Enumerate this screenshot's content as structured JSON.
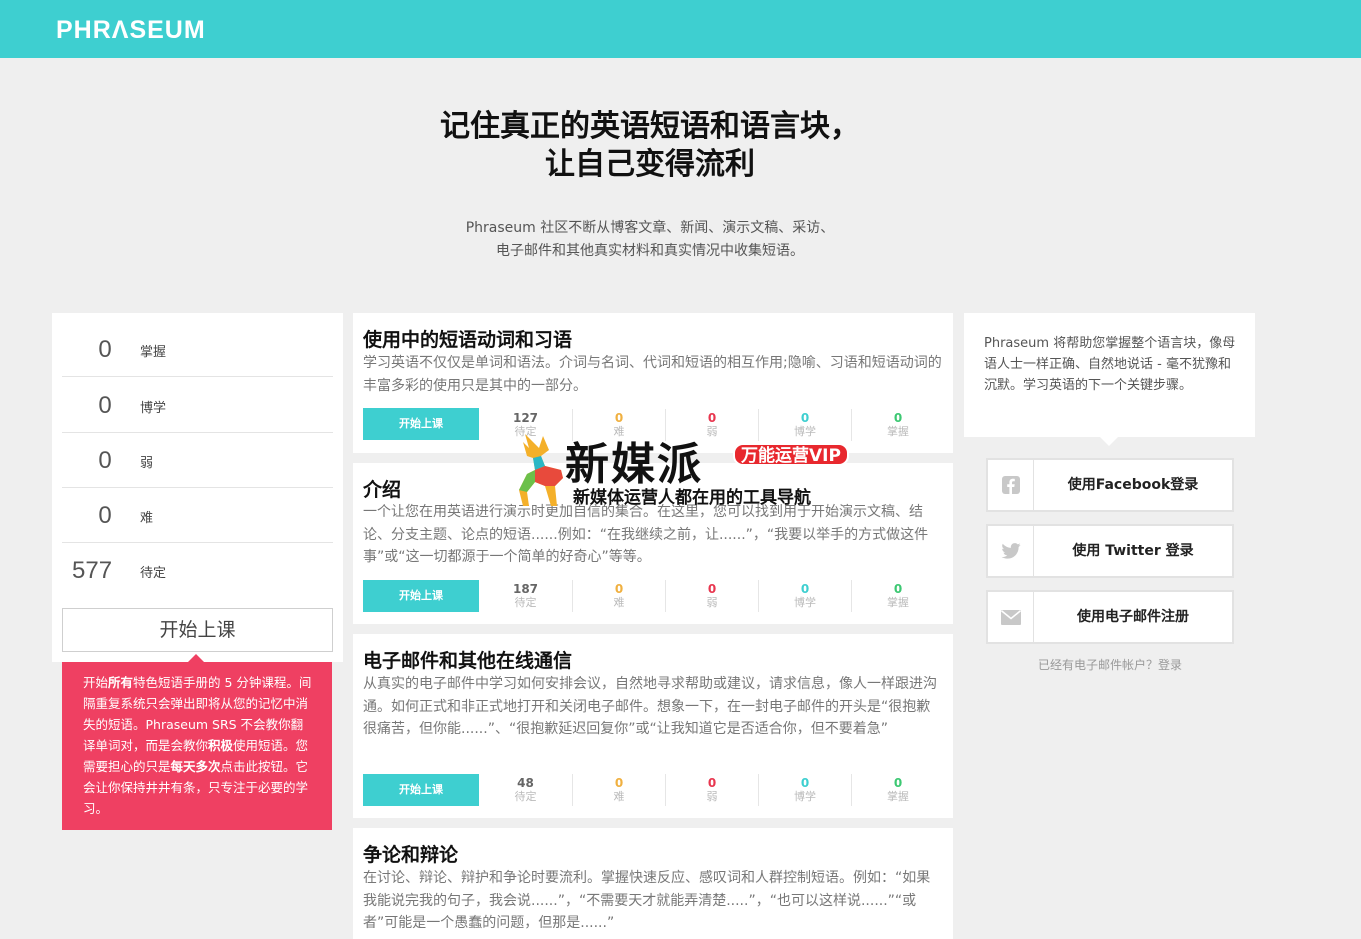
{
  "header": {
    "logo": "PHRΛSEUM"
  },
  "hero": {
    "title_line1": "记住真正的英语短语和语言块，",
    "title_line2": "让自己变得流利",
    "sub_line1": "Phraseum 社区不断从博客文章、新闻、演示文稿、采访、",
    "sub_line2": "电子邮件和其他真实材料和真实情况中收集短语。"
  },
  "stats": [
    {
      "value": "0",
      "label": "掌握"
    },
    {
      "value": "0",
      "label": "博学"
    },
    {
      "value": "0",
      "label": "弱"
    },
    {
      "value": "0",
      "label": "难"
    },
    {
      "value": "577",
      "label": "待定"
    }
  ],
  "start_button": "开始上课",
  "tip": {
    "p1": "开始",
    "b1": "所有",
    "p2": "特色短语手册的 5 分钟课程。间隔重复系统只会弹出即将从您的记忆中消失的短语。Phraseum SRS 不会教你翻译单词对，而是会教你",
    "b2": "积极",
    "p3": "使用短语。您需要担心的只是",
    "b3": "每天多次",
    "p4": "点击此按钮。它会让你保持井井有条，只专注于必要的学习。"
  },
  "cards": [
    {
      "title": "使用中的短语动词和习语",
      "desc": "学习英语不仅仅是单词和语法。介词与名词、代词和短语的相互作用;隐喻、习语和短语动词的丰富多彩的使用只是其中的一部分。",
      "button": "开始上课",
      "metrics": [
        {
          "value": "127",
          "label": "待定"
        },
        {
          "value": "0",
          "label": "难"
        },
        {
          "value": "0",
          "label": "弱"
        },
        {
          "value": "0",
          "label": "博学"
        },
        {
          "value": "0",
          "label": "掌握"
        }
      ]
    },
    {
      "title": "介绍",
      "desc": "一个让您在用英语进行演示时更加自信的集合。在这里，您可以找到用于开始演示文稿、结论、分支主题、论点的短语......例如：“在我继续之前，让......”，“我要以举手的方式做这件事”或“这一切都源于一个简单的好奇心”等等。",
      "button": "开始上课",
      "metrics": [
        {
          "value": "187",
          "label": "待定"
        },
        {
          "value": "0",
          "label": "难"
        },
        {
          "value": "0",
          "label": "弱"
        },
        {
          "value": "0",
          "label": "博学"
        },
        {
          "value": "0",
          "label": "掌握"
        }
      ]
    },
    {
      "title": "电子邮件和其他在线通信",
      "desc": "从真实的电子邮件中学习如何安排会议，自然地寻求帮助或建议，请求信息，像人一样跟进沟通。如何正式和非正式地打开和关闭电子邮件。想象一下，在一封电子邮件的开头是“很抱歉很痛苦，但你能......”、“很抱歉延迟回复你”或“让我知道它是否适合你，但不要着急”",
      "button": "开始上课",
      "metrics": [
        {
          "value": "48",
          "label": "待定"
        },
        {
          "value": "0",
          "label": "难"
        },
        {
          "value": "0",
          "label": "弱"
        },
        {
          "value": "0",
          "label": "博学"
        },
        {
          "value": "0",
          "label": "掌握"
        }
      ]
    },
    {
      "title": "争论和辩论",
      "desc": "在讨论、辩论、辩护和争论时要流利。掌握快速反应、感叹词和人群控制短语。例如：“如果我能说完我的句子，我会说......”，“不需要天才就能弄清楚.....”，“也可以这样说......”“或者”可能是一个愚蠢的问题，但那是......”"
    }
  ],
  "right": {
    "blurb": "Phraseum 将帮助您掌握整个语言块，像母语人士一样正确、自然地说话 - 毫不犹豫和沉默。学习英语的下一个关键步骤。",
    "facebook": "使用Facebook登录",
    "twitter": "使用 Twitter 登录",
    "email": "使用电子邮件注册",
    "already": "已经有电子邮件帐户？登录"
  },
  "watermark": {
    "brand": "新媒派",
    "badge": "万能运营VIP",
    "tagline": "新媒体运营人都在用的工具导航"
  },
  "colors": {
    "accent": "#3ecfd0",
    "tip_bg": "#ef4062",
    "pending": "#666666",
    "hard": "#f0b040",
    "weak": "#e8364f",
    "learned": "#3ecfd0",
    "mastered": "#3cc872"
  }
}
